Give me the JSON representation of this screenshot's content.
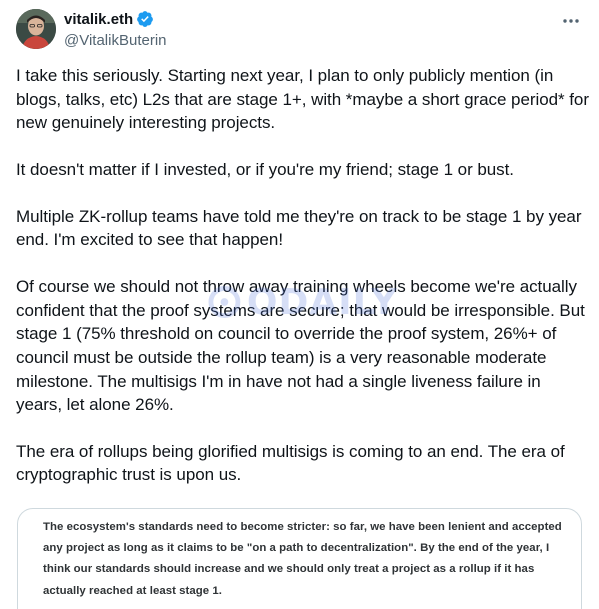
{
  "author": {
    "display_name": "vitalik.eth",
    "handle": "@VitalikButerin",
    "avatar_icon": "avatar-portrait",
    "verified_icon": "verified-badge-icon",
    "verified_color": "#1d9bf0"
  },
  "more_icon": "more-horizontal-icon",
  "tweet": {
    "paragraphs": [
      "I take this seriously. Starting next year, I plan to only publicly mention (in blogs, talks, etc) L2s that are stage 1+, with *maybe a short grace period* for new genuinely interesting projects.",
      "It doesn't matter if I invested, or if you're my friend; stage 1 or bust.",
      "Multiple ZK-rollup teams have told me they're on track to be stage 1 by year end. I'm excited to see that happen!",
      "Of course we should not throw away training wheels become we're actually confident that the proof systems are secure; that would be irresponsible. But stage 1 (75% threshold on council to override the proof system, 26%+ of council must be outside the rollup team) is a very reasonable moderate milestone. The multisigs I'm in have not had a single liveness failure in years, let alone 26%.",
      "The era of rollups being glorified multisigs is coming to an end. The era of cryptographic trust is upon us."
    ]
  },
  "quote": {
    "text": "The ecosystem's standards need to become stricter: so far, we have been lenient and accepted any project as long as it claims to be \"on a path to decentralization\". By the end of the year, I think our standards should increase and we should only treat a project as a rollup if it has actually reached at least stage 1."
  },
  "watermark": {
    "text": "ODAILY",
    "color": "#4a6fd8"
  },
  "colors": {
    "text_primary": "#0f1419",
    "text_secondary": "#536471",
    "border": "#cfd9de"
  }
}
